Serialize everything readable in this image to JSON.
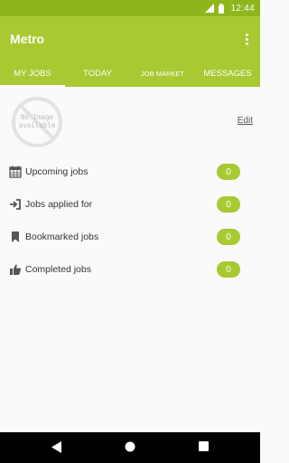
{
  "status_bar": {
    "time": "12:44"
  },
  "app_bar": {
    "title": "Metro"
  },
  "tabs": [
    {
      "label": "MY JOBS"
    },
    {
      "label": "TODAY"
    },
    {
      "label": "JOB MARKET"
    },
    {
      "label": "MESSAGES"
    }
  ],
  "profile": {
    "placeholder_line1": "No Image",
    "placeholder_line2": "available",
    "edit_label": "Edit"
  },
  "job_list": [
    {
      "label": "Upcoming jobs",
      "count": "0",
      "icon": "calendar-icon"
    },
    {
      "label": "Jobs applied for",
      "count": "0",
      "icon": "sign-in-icon"
    },
    {
      "label": "Bookmarked jobs",
      "count": "0",
      "icon": "bookmark-icon"
    },
    {
      "label": "Completed jobs",
      "count": "0",
      "icon": "thumbs-up-icon"
    }
  ],
  "colors": {
    "status_bar": "#8fb51d",
    "app_bar": "#a8c932",
    "badge": "#a8c932"
  }
}
